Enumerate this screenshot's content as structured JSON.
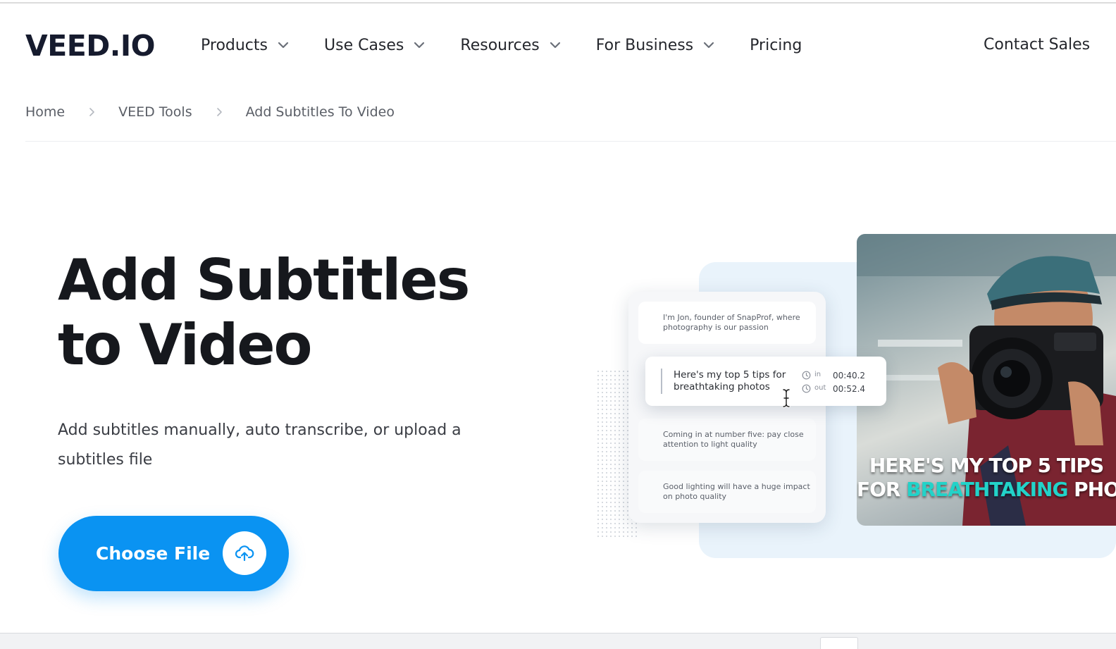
{
  "header": {
    "logo": "VEED.IO",
    "nav": {
      "products": "Products",
      "use_cases": "Use Cases",
      "resources": "Resources",
      "for_business": "For Business",
      "pricing": "Pricing"
    },
    "contact": "Contact Sales"
  },
  "breadcrumb": {
    "home": "Home",
    "tools": "VEED Tools",
    "current": "Add Subtitles To Video"
  },
  "hero": {
    "title_line1": "Add Subtitles",
    "title_line2": "to Video",
    "subtitle": "Add subtitles manually, auto transcribe, or upload a subtitles file",
    "cta": "Choose File"
  },
  "illustration": {
    "subtitles": [
      "I'm Jon, founder of SnapProf, where photography is our passion",
      "Here's my top 5 tips for breathtaking photos",
      "Coming in at number five: pay close attention to light quality",
      "Good lighting will have a huge impact on photo quality"
    ],
    "in_label": "in",
    "out_label": "out",
    "in_time": "00:40.2",
    "out_time": "00:52.4",
    "video_caption_line1": "HERE'S MY TOP 5 TIPS",
    "video_caption_line2_pre": "FOR ",
    "video_caption_line2_accent": "BREATHTAKING",
    "video_caption_line2_post": " PHOTOS"
  },
  "colors": {
    "brand_blue": "#0a93f2",
    "caption_accent": "#22d3c9",
    "text_dark": "#16181d"
  },
  "icons": [
    "chevron-down-icon",
    "chevron-right-icon",
    "upload-cloud-icon",
    "clock-icon",
    "text-cursor-icon"
  ]
}
